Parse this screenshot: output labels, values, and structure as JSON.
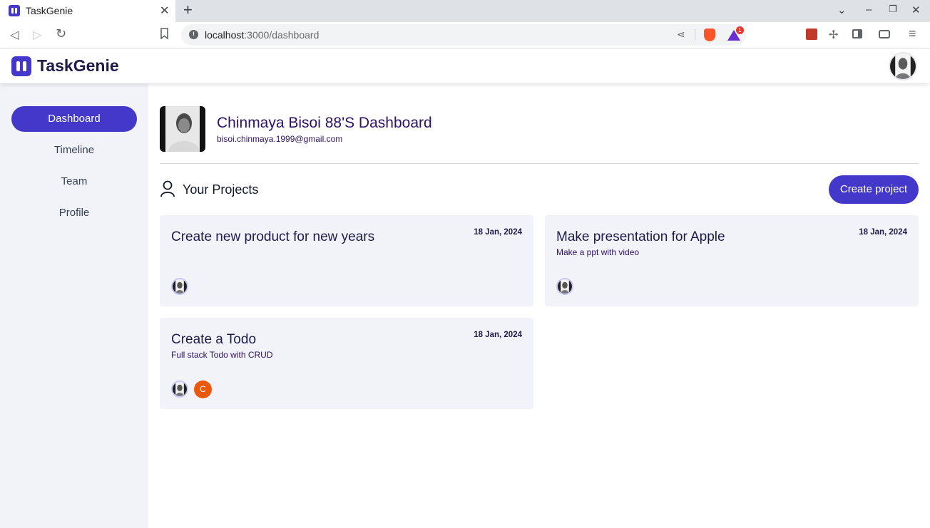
{
  "browser": {
    "tab_title": "TaskGenie",
    "tab_close": "✕",
    "new_tab": "+",
    "url_host": "localhost",
    "url_path": ":3000/dashboard"
  },
  "header": {
    "logo_text": "TaskGenie"
  },
  "sidebar": {
    "items": [
      {
        "label": "Dashboard",
        "active": true
      },
      {
        "label": "Timeline",
        "active": false
      },
      {
        "label": "Team",
        "active": false
      },
      {
        "label": "Profile",
        "active": false
      }
    ]
  },
  "dashboard": {
    "title": "Chinmaya Bisoi 88'S Dashboard",
    "email": "bisoi.chinmaya.1999@gmail.com",
    "projects_heading": "Your Projects",
    "create_button": "Create project"
  },
  "projects": [
    {
      "title": "Create new product for new years",
      "description": "",
      "date": "18 Jan, 2024"
    },
    {
      "title": "Make presentation for Apple",
      "description": "Make a ppt with video",
      "date": "18 Jan, 2024"
    },
    {
      "title": "Create a Todo",
      "description": "Full stack Todo with CRUD",
      "date": "18 Jan, 2024",
      "letter_avatar": "C"
    }
  ],
  "colors": {
    "accent": "#4338ca",
    "sidebar_bg": "#f1f3f8",
    "letter_avatar": "#ea580c"
  }
}
